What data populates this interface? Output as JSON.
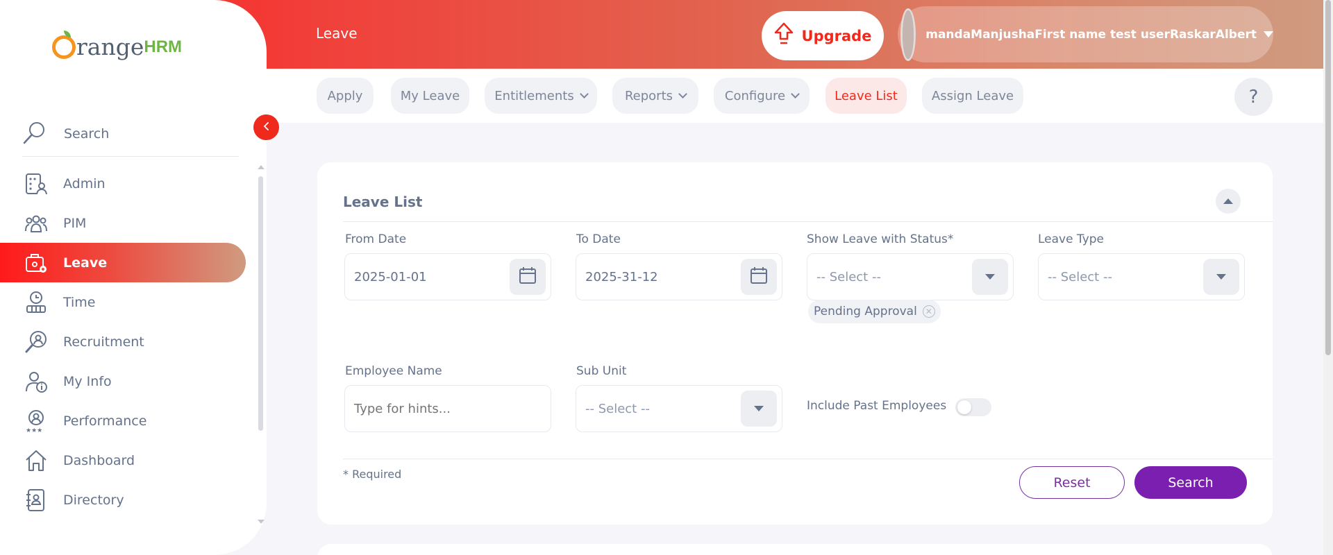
{
  "header": {
    "title": "Leave",
    "upgrade_label": "Upgrade",
    "user_name": "mandaManjushaFirst name test userRaskarAlbert"
  },
  "subnav": {
    "items": [
      {
        "label": "Apply",
        "dropdown": false,
        "active": false
      },
      {
        "label": "My Leave",
        "dropdown": false,
        "active": false
      },
      {
        "label": "Entitlements",
        "dropdown": true,
        "active": false
      },
      {
        "label": "Reports",
        "dropdown": true,
        "active": false
      },
      {
        "label": "Configure",
        "dropdown": true,
        "active": false
      },
      {
        "label": "Leave List",
        "dropdown": false,
        "active": true
      },
      {
        "label": "Assign Leave",
        "dropdown": false,
        "active": false
      }
    ],
    "help_label": "?"
  },
  "sidebar": {
    "logo_text": "range",
    "logo_suffix": "HRM",
    "search_label": "Search",
    "items": [
      {
        "label": "Admin",
        "icon": "admin-icon",
        "active": false
      },
      {
        "label": "PIM",
        "icon": "pim-icon",
        "active": false
      },
      {
        "label": "Leave",
        "icon": "leave-icon",
        "active": true
      },
      {
        "label": "Time",
        "icon": "time-icon",
        "active": false
      },
      {
        "label": "Recruitment",
        "icon": "recruitment-icon",
        "active": false
      },
      {
        "label": "My Info",
        "icon": "my-info-icon",
        "active": false
      },
      {
        "label": "Performance",
        "icon": "performance-icon",
        "active": false
      },
      {
        "label": "Dashboard",
        "icon": "dashboard-icon",
        "active": false
      },
      {
        "label": "Directory",
        "icon": "directory-icon",
        "active": false
      }
    ]
  },
  "filter": {
    "title": "Leave List",
    "from_date_label": "From Date",
    "from_date_value": "2025-01-01",
    "to_date_label": "To Date",
    "to_date_value": "2025-31-12",
    "status_label": "Show Leave with Status*",
    "status_value": "-- Select --",
    "status_chip": "Pending Approval",
    "leave_type_label": "Leave Type",
    "leave_type_value": "-- Select --",
    "employee_label": "Employee Name",
    "employee_placeholder": "Type for hints...",
    "subunit_label": "Sub Unit",
    "subunit_value": "-- Select --",
    "past_employees_label": "Include Past Employees",
    "past_employees_on": false,
    "required_note": "* Required",
    "reset_label": "Reset",
    "search_label": "Search"
  },
  "colors": {
    "brand_red": "#ef2a1d",
    "accent_purple": "#7a1fb0",
    "text": "#64728c"
  }
}
